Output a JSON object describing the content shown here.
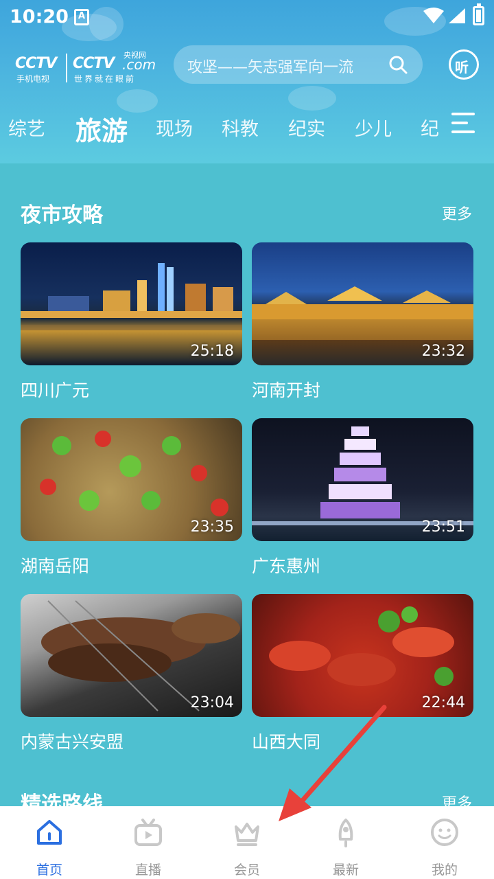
{
  "status_bar": {
    "time": "10:20",
    "notif_letter": "A"
  },
  "header": {
    "logo": {
      "cctv": "CCTV",
      "sub1": "手机电视",
      "cctv2": "CCTV",
      "com": ".com",
      "yangshi": "央视网",
      "sub2": "世界就在眼前"
    },
    "search": {
      "placeholder": "攻坚——矢志强军向一流"
    },
    "listen_label": "听"
  },
  "tabs": {
    "items": [
      "综艺",
      "旅游",
      "现场",
      "科教",
      "纪实",
      "少儿",
      "纪"
    ],
    "active": "旅游"
  },
  "sections": [
    {
      "title": "夜市攻略",
      "more": "更多",
      "videos": [
        {
          "title": "四川广元",
          "duration": "25:18"
        },
        {
          "title": "河南开封",
          "duration": "23:32"
        },
        {
          "title": "湖南岳阳",
          "duration": "23:35"
        },
        {
          "title": "广东惠州",
          "duration": "23:51"
        },
        {
          "title": "内蒙古兴安盟",
          "duration": "23:04"
        },
        {
          "title": "山西大同",
          "duration": "22:44"
        }
      ]
    },
    {
      "title": "精选路线",
      "more": "更多"
    }
  ],
  "bottom_nav": {
    "items": [
      {
        "label": "首页",
        "icon": "home-icon",
        "active": true
      },
      {
        "label": "直播",
        "icon": "tv-icon",
        "active": false
      },
      {
        "label": "会员",
        "icon": "crown-icon",
        "active": false
      },
      {
        "label": "最新",
        "icon": "rocket-icon",
        "active": false
      },
      {
        "label": "我的",
        "icon": "profile-icon",
        "active": false
      }
    ]
  },
  "colors": {
    "accent": "#2b6fe0",
    "background": "#4ec0d0",
    "arrow": "#e8413a"
  }
}
